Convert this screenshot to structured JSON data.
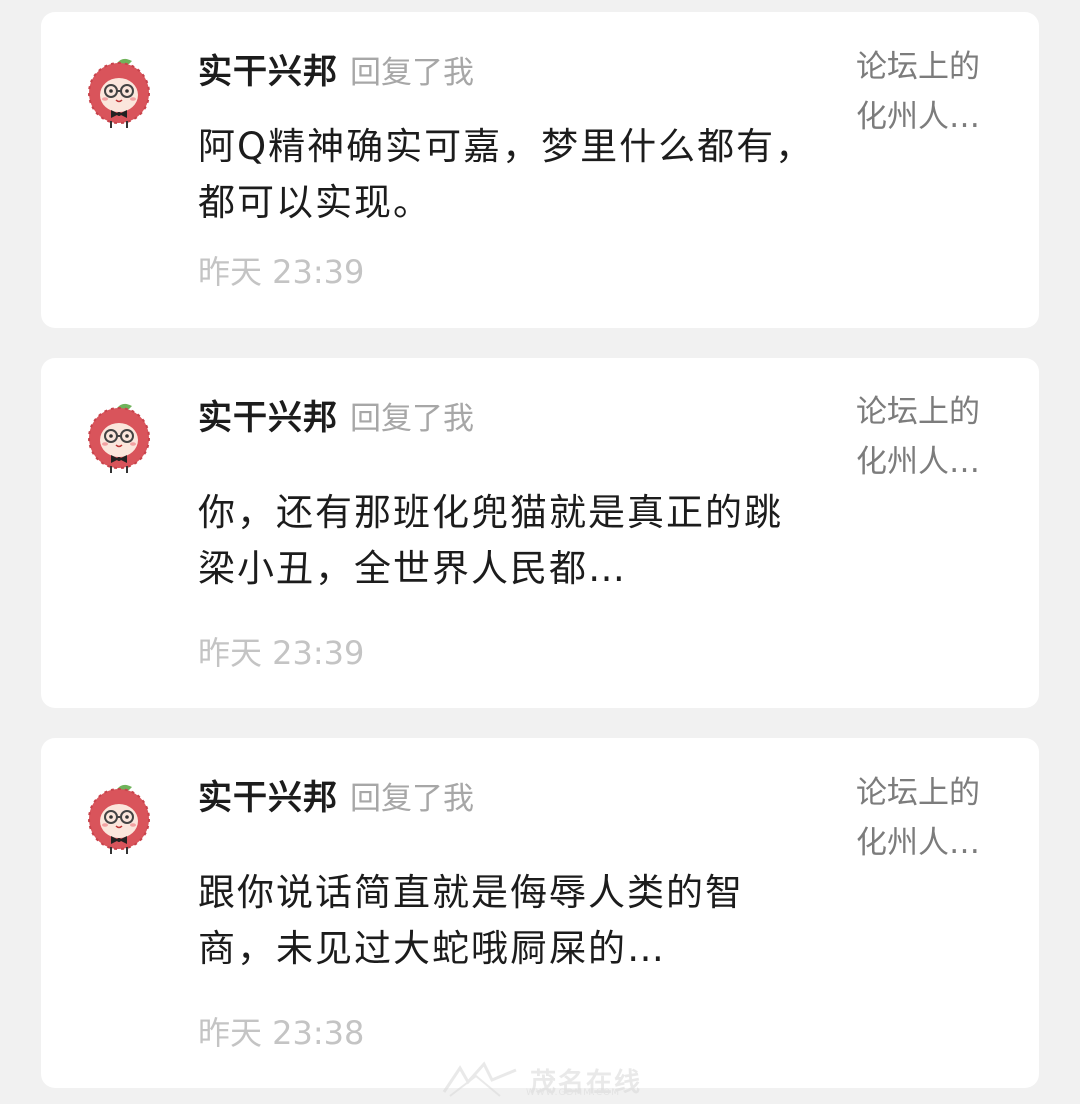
{
  "notifications": [
    {
      "username": "实干兴邦",
      "action": "回复了我",
      "message": "阿Q精神确实可嘉，梦里什么都有，都可以实现。",
      "time": "昨天 23:39",
      "source_line1": "论坛上的",
      "source_line2": "化州人…"
    },
    {
      "username": "实干兴邦",
      "action": "回复了我",
      "message": "你，还有那班化兜猫就是真正的跳梁小丑，全世界人民都…",
      "time": "昨天 23:39",
      "source_line1": "论坛上的",
      "source_line2": "化州人…"
    },
    {
      "username": "实干兴邦",
      "action": "回复了我",
      "message": "跟你说话简直就是侮辱人类的智商，未见过大蛇哦屙屎的…",
      "time": "昨天 23:38",
      "source_line1": "论坛上的",
      "source_line2": "化州人…"
    }
  ],
  "watermark": {
    "text": "茂名在线",
    "url": "WWW.GDMM.COM"
  },
  "colors": {
    "background": "#f1f1f1",
    "card": "#ffffff",
    "username": "#1c1c1c",
    "action": "#a7a7a7",
    "time": "#c4c4c4",
    "source": "#7c7c7c",
    "avatar_face": "#d9545b"
  }
}
